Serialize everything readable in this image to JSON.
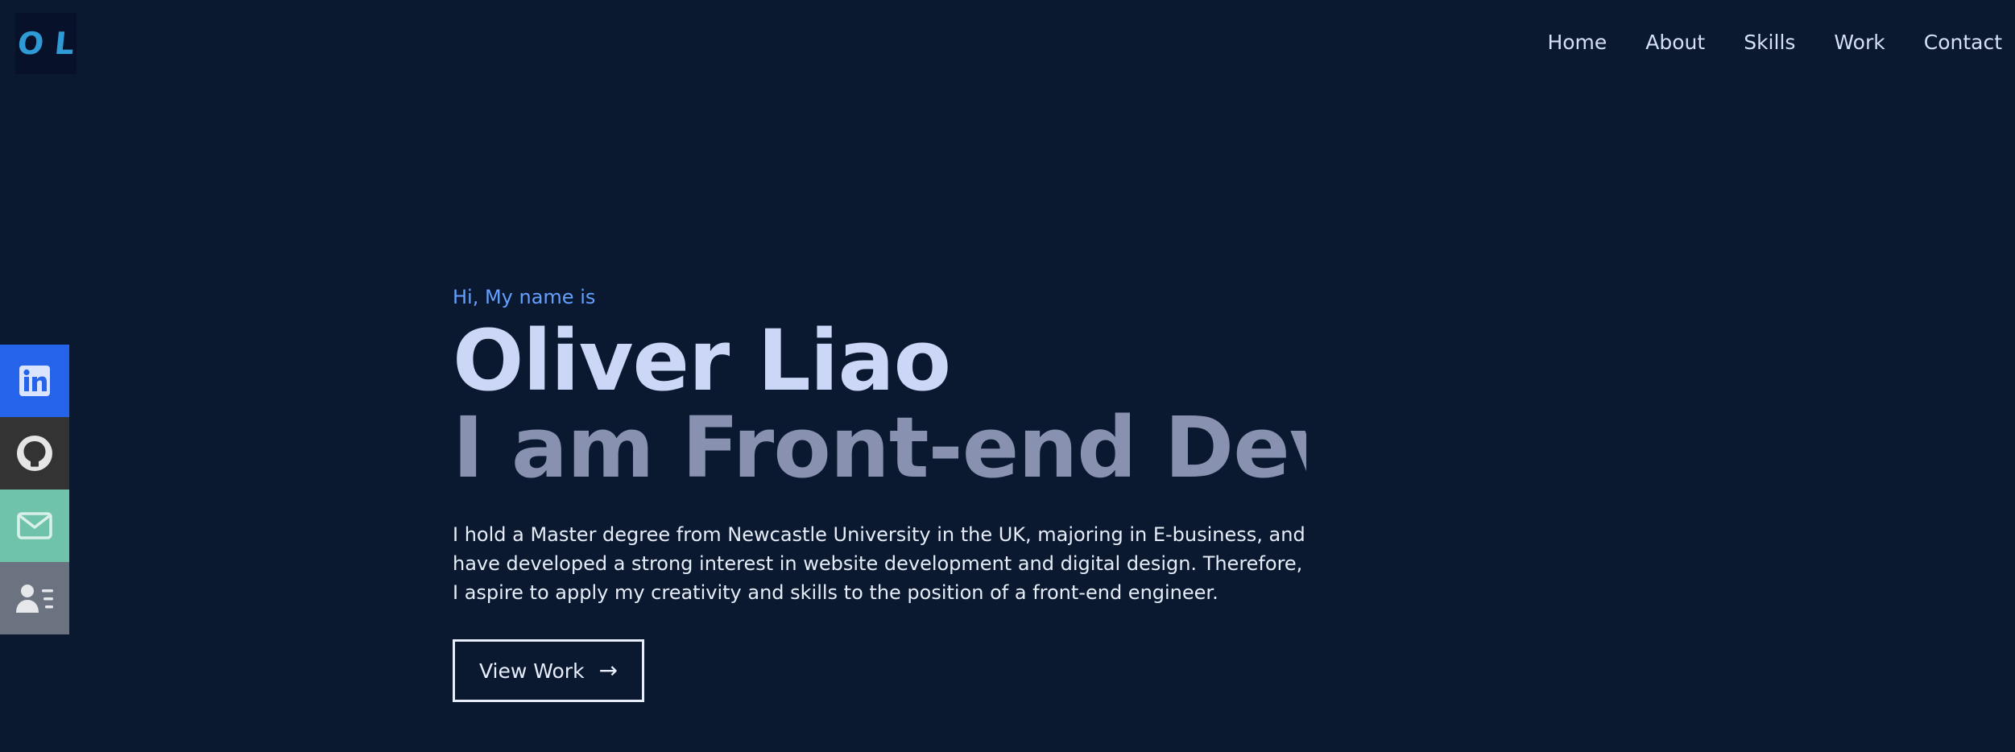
{
  "logo": {
    "letter_1": "O",
    "letter_2": "L"
  },
  "nav": {
    "items": [
      {
        "label": "Home"
      },
      {
        "label": "About"
      },
      {
        "label": "Skills"
      },
      {
        "label": "Work"
      },
      {
        "label": "Contact"
      }
    ]
  },
  "social": {
    "items": [
      {
        "icon": "linkedin-icon",
        "color": "#2563eb"
      },
      {
        "icon": "github-icon",
        "color": "#333333"
      },
      {
        "icon": "mail-icon",
        "color": "#6fc3aa"
      },
      {
        "icon": "resume-icon",
        "color": "#6b7280"
      }
    ]
  },
  "hero": {
    "greeting": "Hi, My name is",
    "name": "Oliver Liao",
    "role": "I am Front-end Deve",
    "description": "I hold a Master degree from Newcastle University in the UK, majoring in E-business, and have developed a strong interest in website development and digital design. Therefore, I aspire to apply my creativity and skills to the position of a front-end engineer.",
    "cta_label": "View Work",
    "cta_arrow": "→"
  },
  "colors": {
    "background": "#0a192f",
    "accent": "#64a0ff",
    "heading": "#ccd6f6",
    "subheading": "#8892b0",
    "logo": "#2f9bd6"
  }
}
